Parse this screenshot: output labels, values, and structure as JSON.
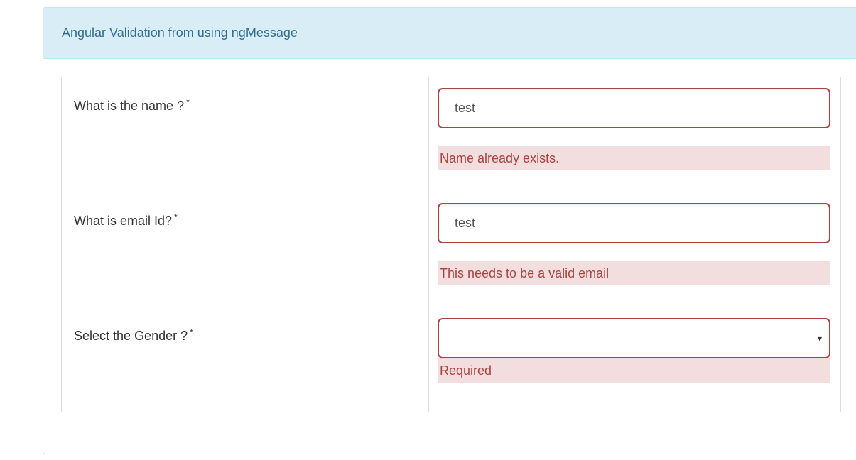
{
  "panel": {
    "title": "Angular Validation from using ngMessage"
  },
  "form": {
    "name": {
      "label": "What is the name ?",
      "required_mark": "*",
      "value": "test",
      "error": "Name already exists."
    },
    "email": {
      "label": "What is email Id?",
      "required_mark": "*",
      "value": "test",
      "error": "This needs to be a valid email"
    },
    "gender": {
      "label": "Select the Gender ?",
      "required_mark": "*",
      "selected_value": "",
      "caret": "▾",
      "error": "Required"
    }
  },
  "colors": {
    "heading_bg": "#d9edf7",
    "heading_text": "#31708f",
    "error_border": "#a94442",
    "error_bg": "#f2dede",
    "error_text": "#a94442"
  }
}
